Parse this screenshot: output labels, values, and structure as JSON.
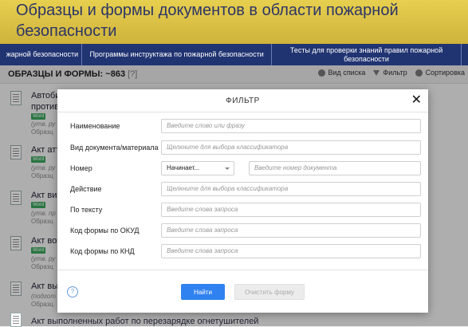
{
  "header": {
    "title": "Образцы и формы документов в области пожарной безопасности"
  },
  "nav": {
    "items": [
      "жарной безопасности",
      "Программы инструктажа по пожарной безопасности",
      "Тесты для проверки знаний правил пожарной безопасности",
      ""
    ]
  },
  "toolbar": {
    "count_label": "ОБРАЗЦЫ И ФОРМЫ: ~863",
    "help_label": "[?]",
    "list_view": "Вид списка",
    "filter": "Фильтр",
    "sort": "Сортировка"
  },
  "documents": [
    {
      "title": "Автоби",
      "title2": "противо",
      "badge": "Word",
      "note": "(утв. ру",
      "meta": "Образц"
    },
    {
      "title": "Акт атт",
      "badge": "Word",
      "note": "(утв. ру",
      "meta": "Образц"
    },
    {
      "title": "Акт виз",
      "badge": "Word",
      "note": "(утв. пр",
      "meta": "Образц"
    },
    {
      "title": "Акт воз",
      "badge": "Word",
      "note": "(утв. ру",
      "meta": "Образц"
    },
    {
      "title": "Акт вып",
      "note": "(подгот",
      "meta": "Образц"
    },
    {
      "title": "Акт выполненных работ по перезарядке огнетушителей"
    }
  ],
  "modal": {
    "title": "ФИЛЬТР",
    "close": "✕",
    "fields": [
      {
        "label": "Наименование",
        "placeholder": "Введите слово или фразу"
      },
      {
        "label": "Вид документа/материала",
        "placeholder": "Щелкните для выбора классификатора"
      },
      {
        "label": "Номер",
        "select": "Начинает...",
        "placeholder": "Введите номер документа"
      },
      {
        "label": "Действие",
        "placeholder": "Щелкните для выбора классификатора"
      },
      {
        "label": "По тексту",
        "placeholder": "Введите слова запроса"
      },
      {
        "label": "Код формы по ОКУД",
        "placeholder": "Введите слова запроса"
      },
      {
        "label": "Код формы по КНД",
        "placeholder": "Введите слова запроса"
      }
    ],
    "help": "?",
    "find_button": "Найти",
    "clear_button": "Очистить форму"
  }
}
